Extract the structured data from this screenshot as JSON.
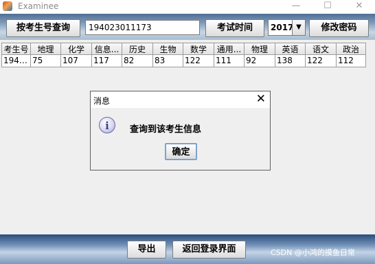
{
  "window": {
    "title": "Examinee",
    "controls": {
      "minimize": "—",
      "maximize": "☐",
      "close": "✕"
    }
  },
  "toolbar": {
    "query_label": "按考生号查询",
    "student_id_value": "194023011173",
    "exam_time_label": "考试时间",
    "year_value": "2017",
    "year_arrow": "▼",
    "change_password_label": "修改密码"
  },
  "table": {
    "headers": [
      "考生号",
      "地理",
      "化学",
      "信息...",
      "历史",
      "生物",
      "数学",
      "通用...",
      "物理",
      "英语",
      "语文",
      "政治"
    ],
    "rows": [
      [
        "1940...",
        "75",
        "107",
        "117",
        "82",
        "83",
        "122",
        "111",
        "92",
        "138",
        "122",
        "112"
      ]
    ]
  },
  "footer": {
    "export_label": "导出",
    "back_label": "返回登录界面",
    "watermark": "CSDN @小鸿的摸鱼日常"
  },
  "dialog": {
    "title": "消息",
    "close": "✕",
    "icon_glyph": "i",
    "message": "查询到该考生信息",
    "ok_label": "确定"
  },
  "colors": {
    "toolbar_top": "#4f6f95",
    "dialog_border": "#5e5e5e",
    "ok_focus": "#7da2ce"
  },
  "icons": {
    "app": "app-icon",
    "info": "information-icon",
    "dropdown": "chevron-down-icon"
  }
}
